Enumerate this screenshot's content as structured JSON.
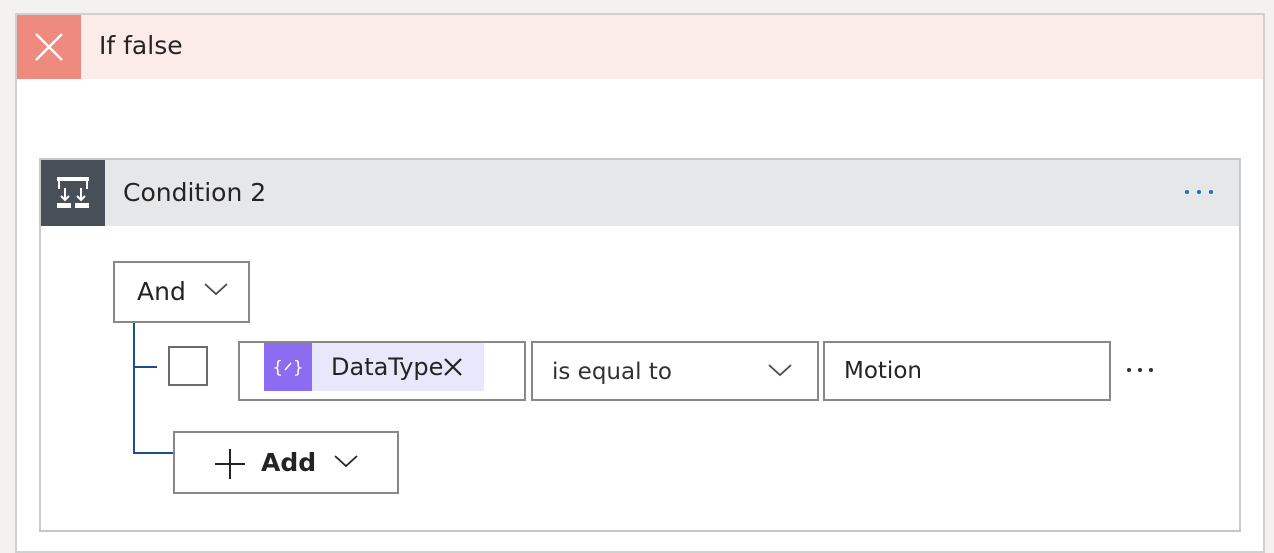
{
  "if_branch": {
    "title": "If false",
    "icon": "close-icon"
  },
  "condition": {
    "title": "Condition 2",
    "icon": "condition-icon",
    "more_icon": "more-icon",
    "group_operator": "And",
    "rows": [
      {
        "token_label": "DataType",
        "token_icon": "expression-icon",
        "operator": "is equal to",
        "value": "Motion"
      }
    ],
    "add_label": "Add"
  },
  "colors": {
    "if_false_header_bg": "#fbecea",
    "if_false_icon_bg": "#ef8a7e",
    "condition_header_bg": "#e6e7e8",
    "condition_icon_bg": "#484f58",
    "token_bg": "#e9e7fb",
    "token_icon_bg": "#8c6cf0",
    "tree_line": "#1f4e8c",
    "more_dots": "#1f6fb5"
  }
}
